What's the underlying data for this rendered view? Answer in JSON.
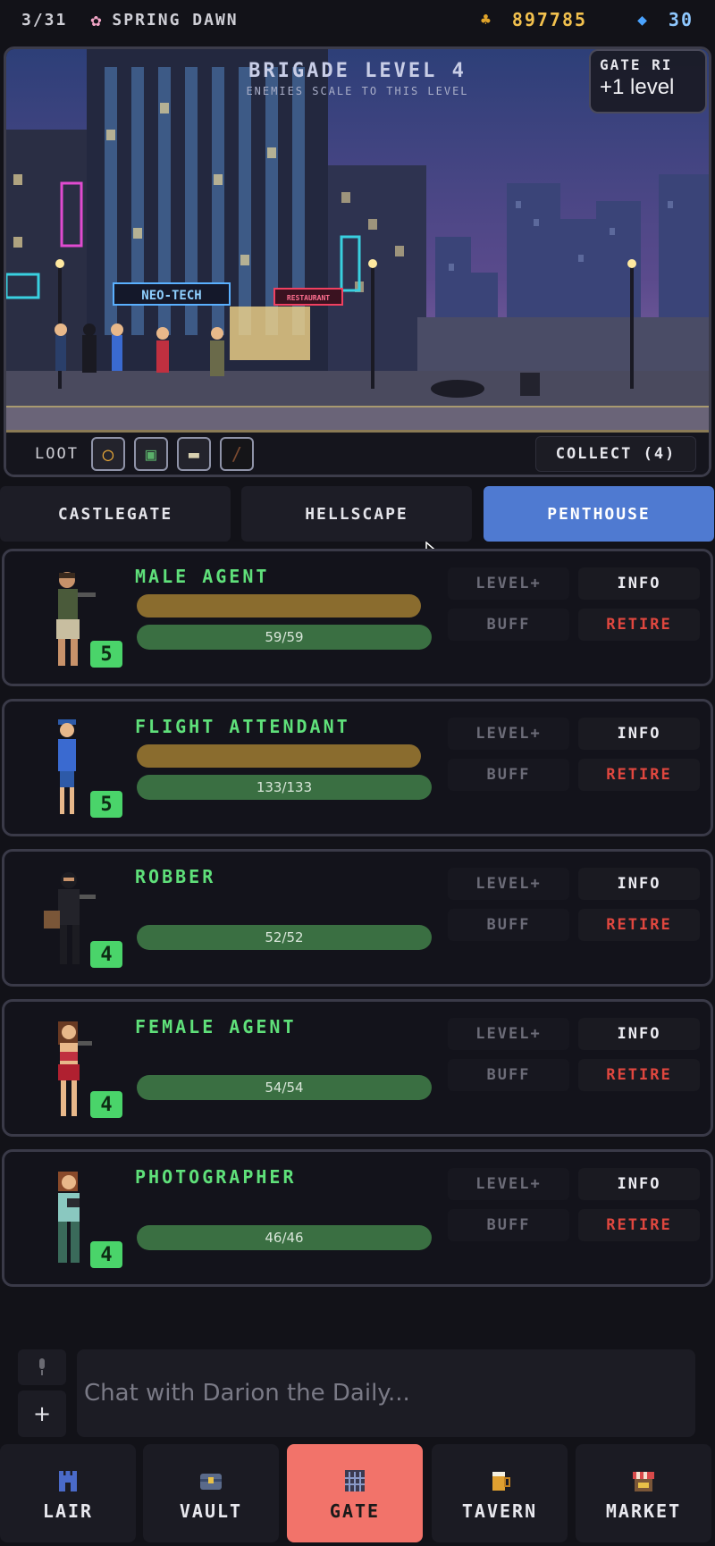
{
  "topbar": {
    "day": "3/31",
    "season": "SPRING DAWN",
    "gold": "897785",
    "gems": "30"
  },
  "scene": {
    "title": "BRIGADE LEVEL 4",
    "subtitle": "ENEMIES SCALE TO THIS LEVEL",
    "gate_label": "GATE RI",
    "gate_value": "+1 level",
    "loot_label": "LOOT",
    "collect_label": "COLLECT (4)",
    "signs": {
      "neotech": "NEO-TECH",
      "restaurant": "RESTAURANT"
    }
  },
  "tabs": [
    {
      "label": "CASTLEGATE",
      "active": false
    },
    {
      "label": "HELLSCAPE",
      "active": false
    },
    {
      "label": "PENTHOUSE",
      "active": true
    }
  ],
  "heroes": [
    {
      "name": "MALE AGENT",
      "level": "5",
      "hp": "59/59",
      "hp_fraction": 1.0,
      "has_xp": true
    },
    {
      "name": "FLIGHT ATTENDANT",
      "level": "5",
      "hp": "133/133",
      "hp_fraction": 1.0,
      "has_xp": true
    },
    {
      "name": "ROBBER",
      "level": "4",
      "hp": "52/52",
      "hp_fraction": 1.0,
      "has_xp": false
    },
    {
      "name": "FEMALE AGENT",
      "level": "4",
      "hp": "54/54",
      "hp_fraction": 1.0,
      "has_xp": false
    },
    {
      "name": "PHOTOGRAPHER",
      "level": "4",
      "hp": "46/46",
      "hp_fraction": 1.0,
      "has_xp": false
    }
  ],
  "actions": {
    "level_up": "LEVEL+",
    "info": "INFO",
    "buff": "BUFF",
    "retire": "RETIRE"
  },
  "chat": {
    "placeholder": "Chat with Darion the Daily...",
    "plus": "+"
  },
  "nav": [
    {
      "label": "LAIR",
      "icon": "castle-icon"
    },
    {
      "label": "VAULT",
      "icon": "chest-icon"
    },
    {
      "label": "GATE",
      "icon": "gate-icon",
      "active": true
    },
    {
      "label": "TAVERN",
      "icon": "beer-icon"
    },
    {
      "label": "MARKET",
      "icon": "stall-icon"
    }
  ],
  "colors": {
    "accent_tab": "#4f7ad1",
    "active_nav": "#f2736a",
    "hero_name": "#5fe07a",
    "retire": "#e0473f",
    "gold": "#f2c14e"
  }
}
